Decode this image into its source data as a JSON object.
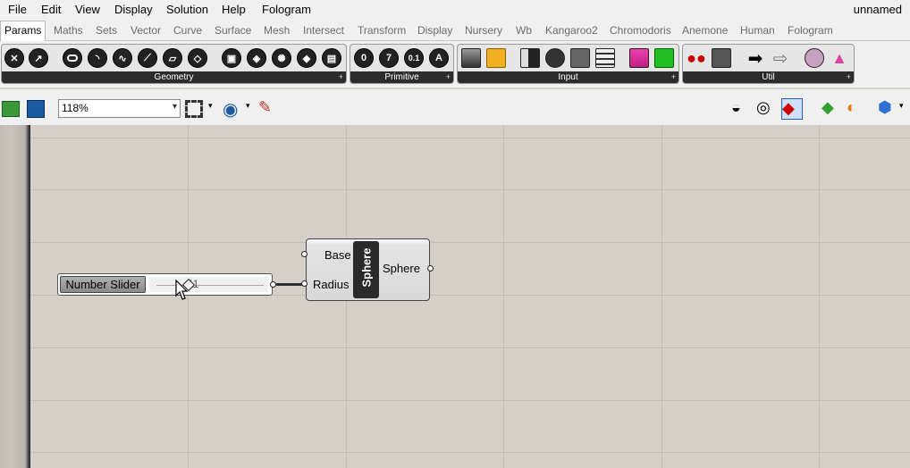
{
  "menu": [
    "File",
    "Edit",
    "View",
    "Display",
    "Solution",
    "Help",
    "Fologram"
  ],
  "document": {
    "name": "unnamed"
  },
  "tabs": [
    "Params",
    "Maths",
    "Sets",
    "Vector",
    "Curve",
    "Surface",
    "Mesh",
    "Intersect",
    "Transform",
    "Display",
    "Nursery",
    "Wb",
    "Kangaroo2",
    "Chromodoris",
    "Anemone",
    "Human",
    "Fologram"
  ],
  "active_tab": "Params",
  "ribbon": {
    "panels": [
      "Geometry",
      "Primitive",
      "Input",
      "Util"
    ],
    "primitive_glyphs": [
      "0",
      "7",
      "0.1",
      "A"
    ],
    "expand_glyph": "+"
  },
  "toolbar": {
    "zoom": "118%"
  },
  "canvas": {
    "slider": {
      "label": "Number Slider",
      "value": "11",
      "fraction": 0.3
    },
    "component": {
      "name": "Sphere",
      "inputs": [
        "Base",
        "Radius"
      ],
      "outputs": [
        "Sphere"
      ]
    }
  },
  "colors": {
    "canvas": "#d4d0c8",
    "wire": "#2e2e2e",
    "component_core": "#2a2a2a"
  }
}
